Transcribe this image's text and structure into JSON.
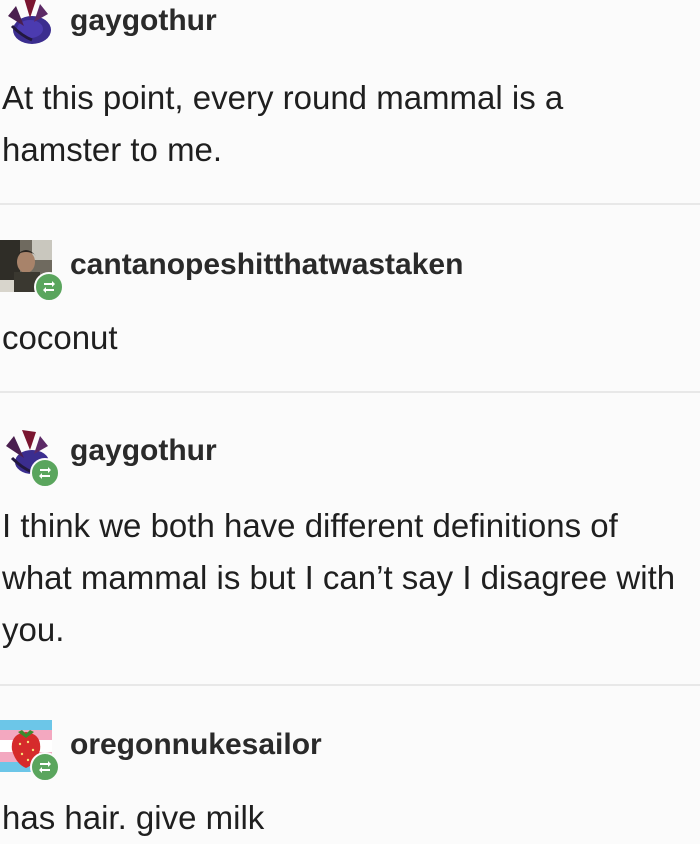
{
  "posts": [
    {
      "username": "gaygothur",
      "text": "At this point, every round mammal is a\nhamster to me.",
      "avatar_icon": "bat-creature-icon",
      "reblog": false
    },
    {
      "username": "cantanopeshitthatwastaken",
      "text": "coconut",
      "avatar_icon": "person-photo-avatar",
      "reblog": true
    },
    {
      "username": "gaygothur",
      "text": "I think we both have different definitions of\nwhat mammal is but I can’t say I disagree with\nyou.",
      "avatar_icon": "bat-creature-icon",
      "reblog": true
    },
    {
      "username": "oregonnukesailor",
      "text": "has hair. give milk",
      "avatar_icon": "strawberry-flag-icon",
      "reblog": true
    }
  ],
  "colors": {
    "background": "#fbfbfb",
    "divider": "#e8e8e8",
    "reblog_badge": "#5aa55d",
    "text": "#1f1f1f"
  }
}
